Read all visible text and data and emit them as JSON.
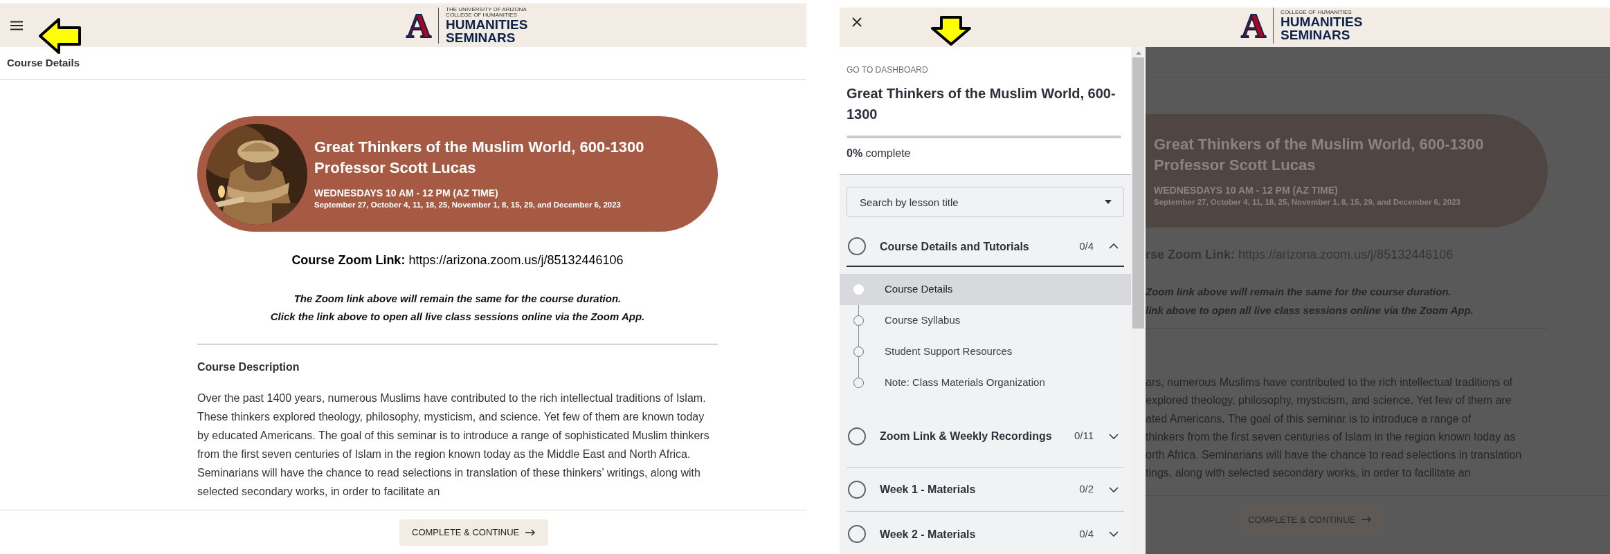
{
  "main_view": {
    "header": {
      "logo": {
        "mark": "A",
        "small_lines": [
          "THE UNIVERSITY OF ARIZONA",
          "COLLEGE OF HUMANITIES"
        ],
        "title_lines": [
          "HUMANITIES",
          "SEMINARS"
        ]
      }
    },
    "breadcrumb": "Course Details",
    "banner": {
      "title": "Great Thinkers of the Muslim World, 600-1300",
      "instructor": "Professor Scott Lucas",
      "schedule": "WEDNESDAYS 10 AM - 12 PM (AZ TIME)",
      "dates": "September 27, October 4, 11, 18, 25, November 1, 8, 15, 29, and December 6, 2023"
    },
    "zoom_link": {
      "label": "Course Zoom Link:",
      "url": "https://arizona.zoom.us/j/85132446106"
    },
    "notes": [
      "The Zoom link above will remain the same for the course duration.",
      "Click the link above to open all live class sessions online via the Zoom App."
    ],
    "description": {
      "heading": "Course Description",
      "text": "Over the past 1400 years, numerous Muslims have contributed to the rich intellectual traditions of Islam. These thinkers explored theology, philosophy, mysticism, and science. Yet few of them are known today by educated Americans. The goal of this seminar is to introduce a range of sophisticated Muslim thinkers from the first seven centuries of Islam in the region known today as the Middle East and North Africa. Seminarians will have the chance to read selections in translation of these thinkers’ writings, along with selected secondary works, in order to facilitate an"
    },
    "continue_button": "COMPLETE & CONTINUE"
  },
  "menu_view": {
    "header": {
      "logo": {
        "mark": "A",
        "small_lines": [
          "COLLEGE OF HUMANITIES"
        ],
        "title_lines": [
          "HUMANITIES",
          "SEMINARS"
        ]
      }
    },
    "sidebar": {
      "dashboard_link": "GO TO DASHBOARD",
      "course_title": "Great Thinkers of the Muslim World, 600-1300",
      "progress": {
        "level": 0,
        "text": "**0%** complete"
      },
      "search": {
        "placeholder": "Search by lesson title"
      },
      "sections": [
        {
          "title": "Course Details and Tutorials",
          "count": "0/4",
          "expanded": true,
          "lessons": [
            {
              "title": "Course Details",
              "selected": true
            },
            {
              "title": "Course Syllabus",
              "selected": false
            },
            {
              "title": "Student Support Resources",
              "selected": false
            },
            {
              "title": "Note: Class Materials Organization",
              "selected": false
            }
          ]
        },
        {
          "title": "Zoom Link & Weekly Recordings",
          "count": "0/11",
          "expanded": false
        },
        {
          "title": "Week 1 - Materials",
          "count": "0/2",
          "expanded": false
        },
        {
          "title": "Week 2 - Materials",
          "count": "0/4",
          "expanded": false
        }
      ]
    },
    "page_behind": {
      "banner": {
        "title": "Great Thinkers of the Muslim World, 600-1300",
        "instructor": "Professor Scott Lucas",
        "schedule": "WEDNESDAYS 10 AM - 12 PM (AZ TIME)",
        "dates": "September 27, October 4, 11, 18, 25, November 1, 8, 15, 29, and December 6, 2023"
      },
      "zoom_link": {
        "label": "rse Zoom Link:",
        "url": "https://arizona.zoom.us/j/85132446106"
      },
      "note_lines": [
        "Zoom link above will remain the same for the course duration.",
        "link above to open all live class sessions online via the Zoom App."
      ],
      "description_lines": [
        "ars, numerous Muslims have contributed to the rich intellectual traditions of",
        "explored theology, philosophy, mysticism, and science. Yet few of them are",
        "ated Americans. The goal of this seminar is to introduce a range of",
        "thinkers from the first seven centuries of Islam in the region known today as",
        "orth Africa. Seminarians will have the chance to read selections in translation",
        "tings, along with selected secondary works, in order to facilitate an"
      ],
      "continue_button": "COMPLETE & CONTINUE"
    }
  }
}
